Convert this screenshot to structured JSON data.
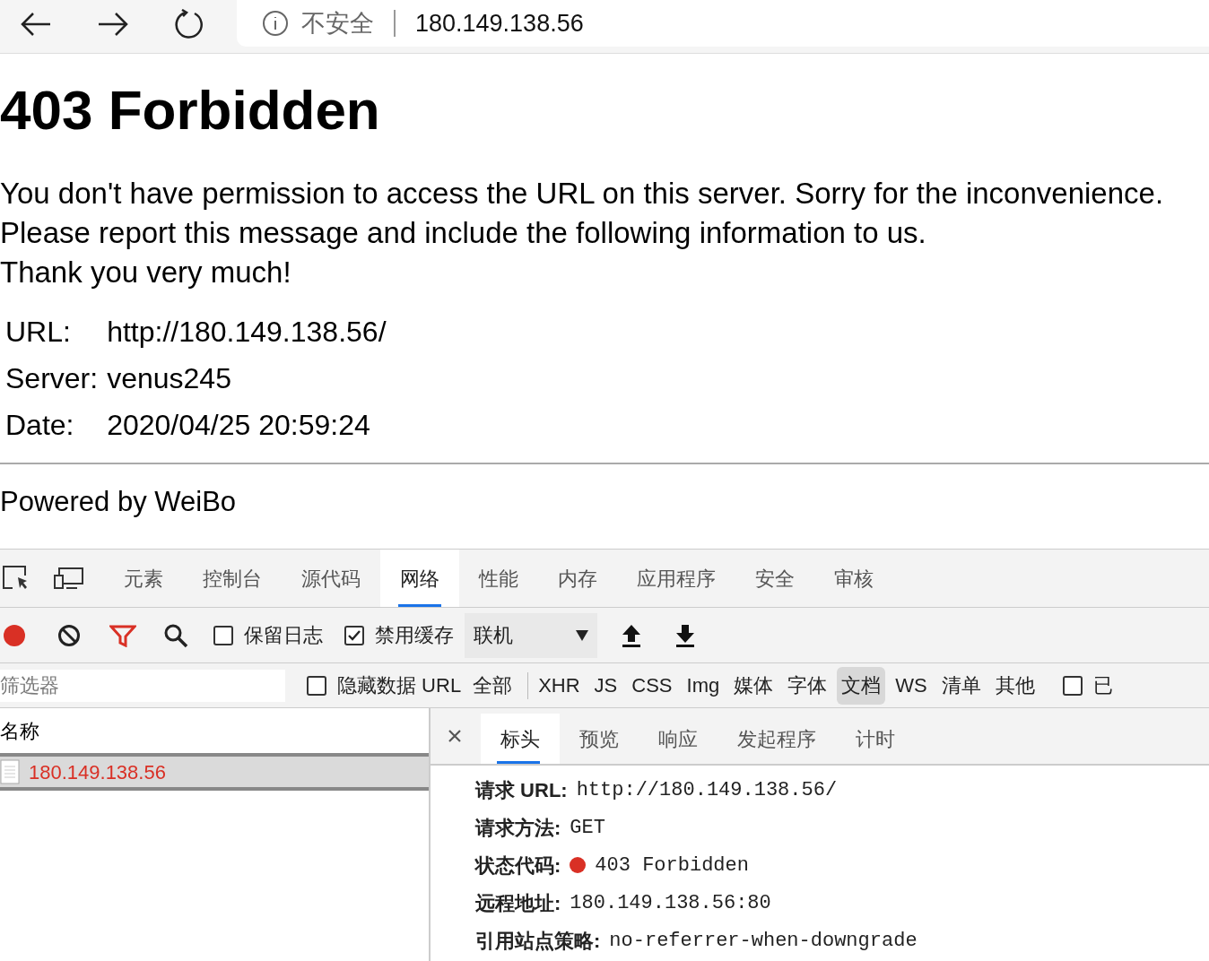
{
  "browser": {
    "security_label": "不安全",
    "address": "180.149.138.56"
  },
  "page": {
    "heading": "403 Forbidden",
    "lines": [
      "You don't have permission to access the URL on this server. Sorry for the inconvenience.",
      "Please report this message and include the following information to us.",
      "Thank you very much!"
    ],
    "info": [
      {
        "label": "URL:",
        "value": "http://180.149.138.56/"
      },
      {
        "label": "Server:",
        "value": "venus245"
      },
      {
        "label": "Date:",
        "value": "2020/04/25 20:59:24"
      }
    ],
    "footer": "Powered by WeiBo"
  },
  "devtools": {
    "tabs": [
      {
        "label": "元素",
        "selected": false
      },
      {
        "label": "控制台",
        "selected": false
      },
      {
        "label": "源代码",
        "selected": false
      },
      {
        "label": "网络",
        "selected": true
      },
      {
        "label": "性能",
        "selected": false
      },
      {
        "label": "内存",
        "selected": false
      },
      {
        "label": "应用程序",
        "selected": false
      },
      {
        "label": "安全",
        "selected": false
      },
      {
        "label": "审核",
        "selected": false
      }
    ],
    "toolbar": {
      "recording": true,
      "preserve_log": {
        "label": "保留日志",
        "checked": false
      },
      "disable_cache": {
        "label": "禁用缓存",
        "checked": true
      },
      "throttle": "联机"
    },
    "filter": {
      "placeholder": "筛选器",
      "hide_data_urls": {
        "label": "隐藏数据 URL",
        "checked": false
      },
      "types": [
        {
          "label": "全部",
          "selected": false
        },
        {
          "label": "XHR",
          "selected": false
        },
        {
          "label": "JS",
          "selected": false
        },
        {
          "label": "CSS",
          "selected": false
        },
        {
          "label": "Img",
          "selected": false
        },
        {
          "label": "媒体",
          "selected": false
        },
        {
          "label": "字体",
          "selected": false
        },
        {
          "label": "文档",
          "selected": true
        },
        {
          "label": "WS",
          "selected": false
        },
        {
          "label": "清单",
          "selected": false
        },
        {
          "label": "其他",
          "selected": false
        }
      ],
      "blocked": {
        "label": "已",
        "checked": false
      }
    },
    "requests": {
      "column": "名称",
      "rows": [
        {
          "name": "180.149.138.56",
          "selected": true
        }
      ]
    },
    "detail": {
      "tabs": [
        {
          "label": "标头",
          "selected": true
        },
        {
          "label": "预览",
          "selected": false
        },
        {
          "label": "响应",
          "selected": false
        },
        {
          "label": "发起程序",
          "selected": false
        },
        {
          "label": "计时",
          "selected": false
        }
      ],
      "headers": [
        {
          "label": "请求 URL:",
          "value": "http://180.149.138.56/"
        },
        {
          "label": "请求方法:",
          "value": "GET"
        },
        {
          "label": "状态代码:",
          "value": "403 Forbidden",
          "color": "#d93025"
        },
        {
          "label": "远程地址:",
          "value": "180.149.138.56:80"
        },
        {
          "label": "引用站点策略:",
          "value": "no-referrer-when-downgrade"
        }
      ]
    }
  }
}
